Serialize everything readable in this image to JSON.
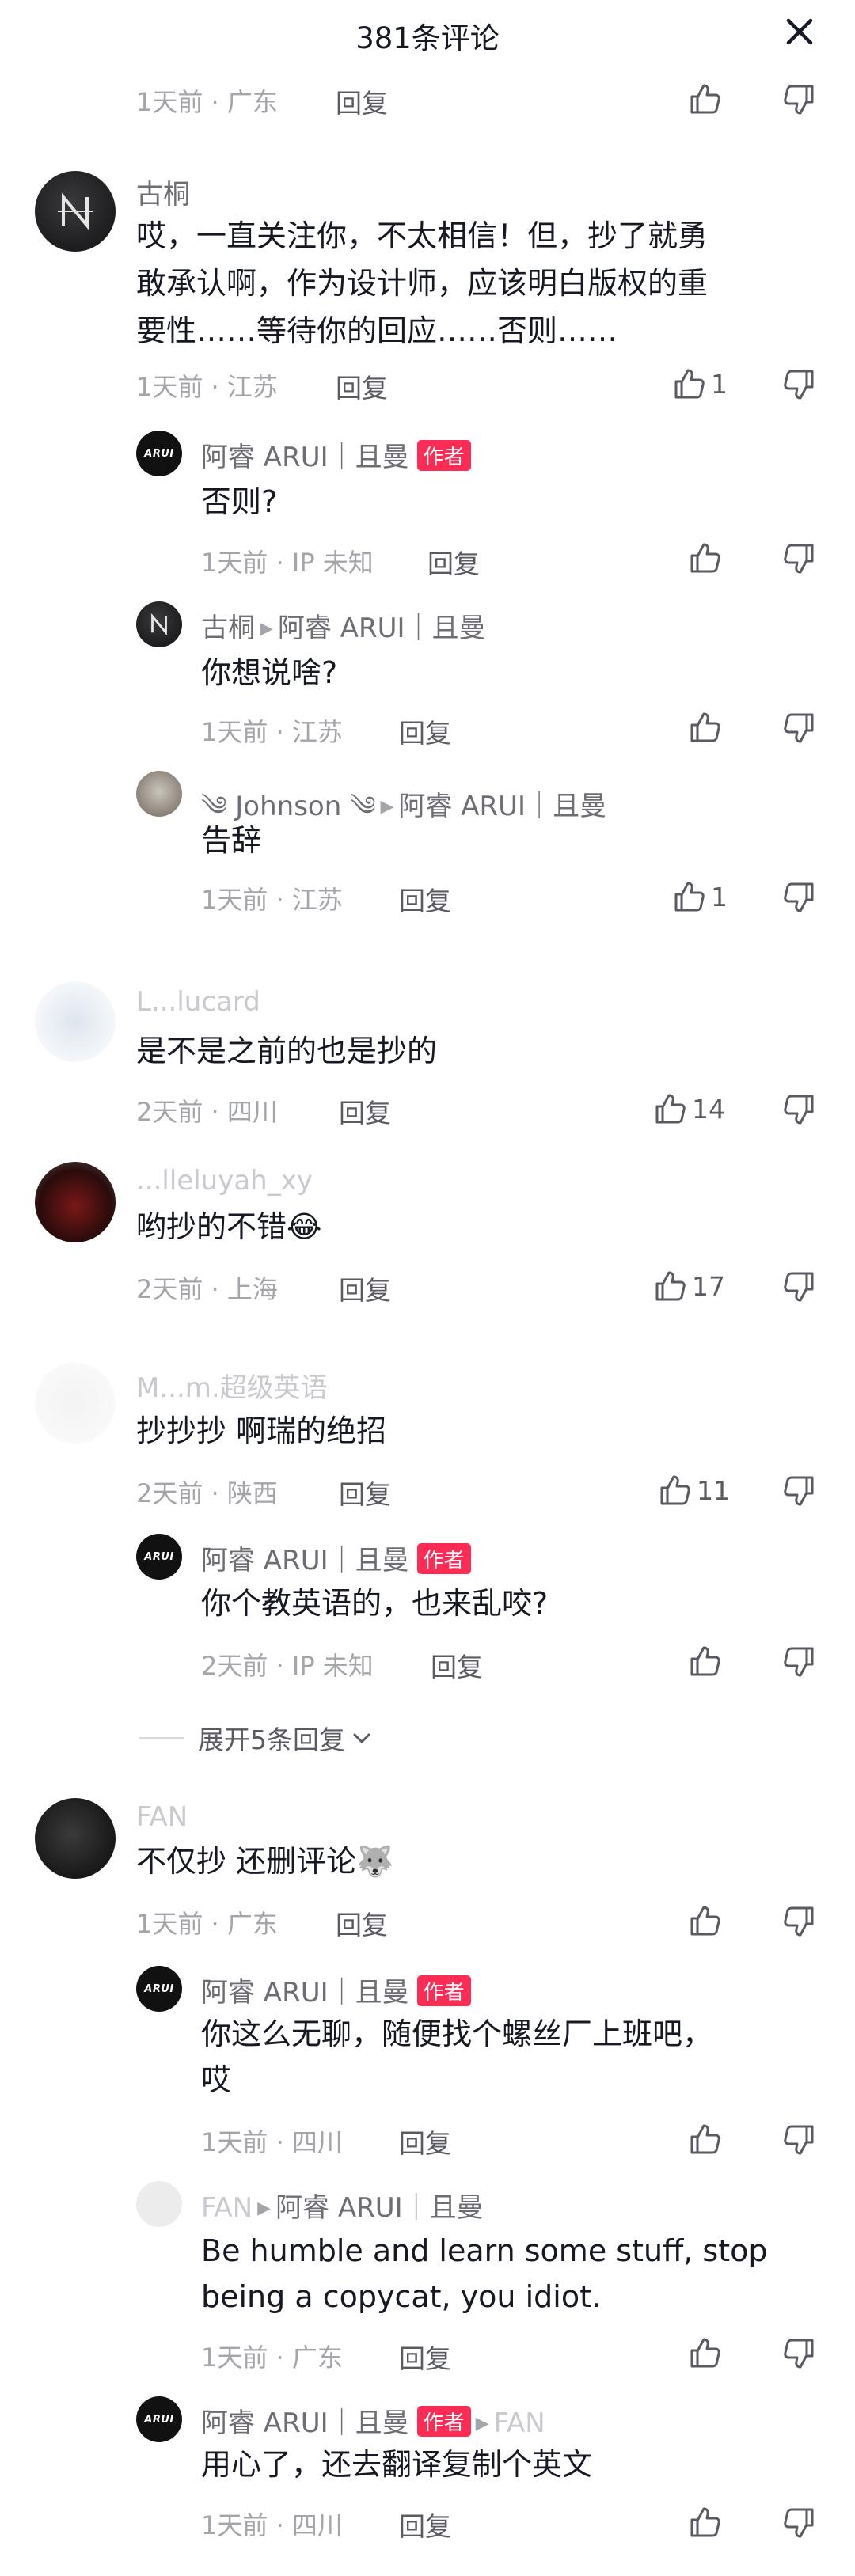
{
  "header": {
    "title": "381条评论"
  },
  "labels": {
    "reply": "回复",
    "author_tag": "作者"
  },
  "expand": {
    "label": "展开5条回复"
  },
  "items": [
    {
      "type": "meta-only",
      "time_loc": "1天前 · 广东",
      "likes": ""
    },
    {
      "type": "comment",
      "user": "古桐",
      "lines": [
        "哎，一直关注你，不太相信！但，抄了就勇",
        "敢承认啊，作为设计师，应该明白版权的重",
        "要性……等待你的回应……否则……"
      ],
      "time_loc": "1天前 · 江苏",
      "likes": "1"
    },
    {
      "type": "reply",
      "user": "阿睿 ARUI｜且曼",
      "author": true,
      "lines": [
        "否则?"
      ],
      "time_loc": "1天前 · IP 未知",
      "likes": ""
    },
    {
      "type": "reply",
      "user": "古桐",
      "reply_to": "阿睿 ARUI｜且曼",
      "lines": [
        "你想说啥?"
      ],
      "time_loc": "1天前 · 江苏",
      "likes": ""
    },
    {
      "type": "reply",
      "user": "༄ Johnson ༄",
      "reply_to": "阿睿 ARUI｜且曼",
      "lines": [
        "告辞"
      ],
      "time_loc": "1天前 · 江苏",
      "likes": "1"
    },
    {
      "type": "comment",
      "user": "L...lucard",
      "lines": [
        "是不是之前的也是抄的"
      ],
      "time_loc": "2天前 · 四川",
      "likes": "14"
    },
    {
      "type": "comment",
      "user": "...lleluyah_xy",
      "lines": [
        "哟抄的不错😂"
      ],
      "time_loc": "2天前 · 上海",
      "likes": "17"
    },
    {
      "type": "comment",
      "user": "M...m.超级英语",
      "lines": [
        "抄抄抄 啊瑞的绝招"
      ],
      "time_loc": "2天前 · 陕西",
      "likes": "11"
    },
    {
      "type": "reply",
      "user": "阿睿 ARUI｜且曼",
      "author": true,
      "lines": [
        "你个教英语的，也来乱咬?"
      ],
      "time_loc": "2天前 · IP 未知",
      "likes": ""
    },
    {
      "type": "comment",
      "user": "FAN",
      "lines": [
        "不仅抄 还删评论🐺"
      ],
      "time_loc": "1天前 · 广东",
      "likes": ""
    },
    {
      "type": "reply",
      "user": "阿睿 ARUI｜且曼",
      "author": true,
      "lines": [
        "你这么无聊，随便找个螺丝厂上班吧，",
        "哎"
      ],
      "time_loc": "1天前 · 四川",
      "likes": ""
    },
    {
      "type": "reply",
      "user": "FAN",
      "reply_to": "阿睿 ARUI｜且曼",
      "lines": [
        "Be humble and learn some stuff, stop",
        "being a copycat, you idiot."
      ],
      "time_loc": "1天前 · 广东",
      "likes": ""
    },
    {
      "type": "reply",
      "user": "阿睿 ARUI｜且曼",
      "author": true,
      "reply_to": "FAN",
      "lines": [
        "用心了，还去翻译复制个英文"
      ],
      "time_loc": "1天前 · 四川",
      "likes": ""
    }
  ],
  "avatars": {
    "arui_text": "ARUI"
  },
  "icons": [
    "close-icon",
    "thumbs-up-icon",
    "thumbs-down-icon",
    "chevron-down-icon",
    "play-arrow-icon"
  ],
  "colors": {
    "author_tag": "#fe2c55",
    "text": "#161823",
    "meta": "#a4a5ab"
  }
}
